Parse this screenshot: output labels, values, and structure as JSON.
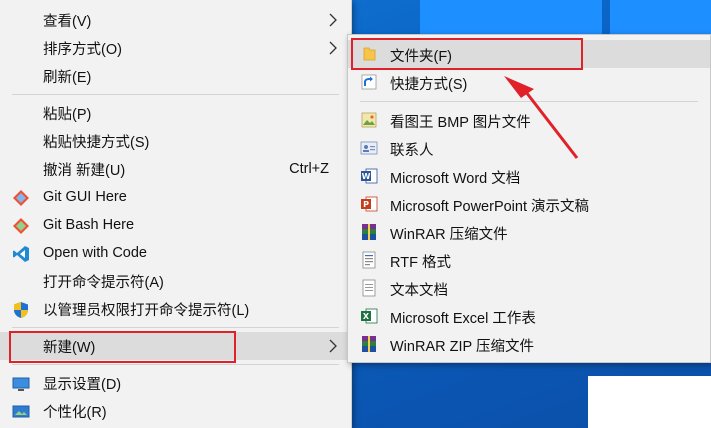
{
  "main_menu": {
    "items": [
      {
        "label": "查看(V)",
        "shortcut": ""
      },
      {
        "label": "排序方式(O)",
        "shortcut": ""
      },
      {
        "label": "刷新(E)",
        "shortcut": ""
      },
      {
        "label": "粘贴(P)",
        "shortcut": ""
      },
      {
        "label": "粘贴快捷方式(S)",
        "shortcut": ""
      },
      {
        "label": "撤消 新建(U)",
        "shortcut": "Ctrl+Z"
      },
      {
        "label": "Git GUI Here",
        "shortcut": ""
      },
      {
        "label": "Git Bash Here",
        "shortcut": ""
      },
      {
        "label": "Open with Code",
        "shortcut": ""
      },
      {
        "label": "打开命令提示符(A)",
        "shortcut": ""
      },
      {
        "label": "以管理员权限打开命令提示符(L)",
        "shortcut": ""
      },
      {
        "label": "新建(W)",
        "shortcut": ""
      },
      {
        "label": "显示设置(D)",
        "shortcut": ""
      },
      {
        "label": "个性化(R)",
        "shortcut": ""
      }
    ]
  },
  "new_submenu": {
    "items": [
      {
        "label": "文件夹(F)"
      },
      {
        "label": "快捷方式(S)"
      },
      {
        "label": "看图王 BMP 图片文件"
      },
      {
        "label": "联系人"
      },
      {
        "label": "Microsoft Word 文档"
      },
      {
        "label": "Microsoft PowerPoint 演示文稿"
      },
      {
        "label": "WinRAR 压缩文件"
      },
      {
        "label": "RTF 格式"
      },
      {
        "label": "文本文档"
      },
      {
        "label": "Microsoft Excel 工作表"
      },
      {
        "label": "WinRAR ZIP 压缩文件"
      }
    ]
  },
  "colors": {
    "highlight_box": "#e0212a",
    "menu_bg": "#f2f2f2",
    "hover_bg": "#dcdcdc"
  }
}
